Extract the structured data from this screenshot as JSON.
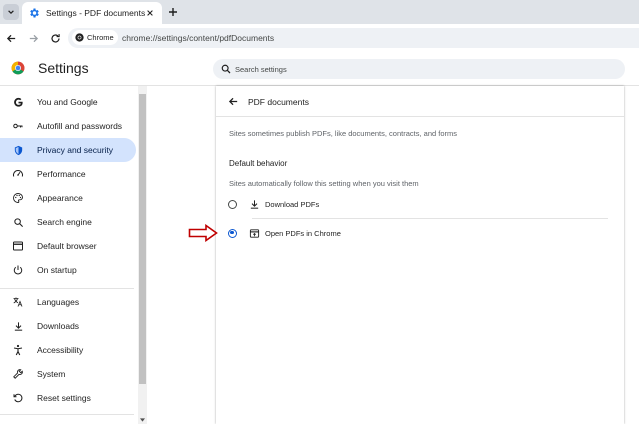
{
  "browser": {
    "tab": {
      "title": "Settings - PDF documents"
    },
    "chip_label": "Chrome",
    "url": "chrome://settings/content/pdfDocuments"
  },
  "header": {
    "title": "Settings",
    "search_placeholder": "Search settings"
  },
  "sidebar": {
    "items": [
      {
        "label": "You and Google",
        "icon": "google-icon",
        "active": false
      },
      {
        "label": "Autofill and passwords",
        "icon": "key-icon",
        "active": false
      },
      {
        "label": "Privacy and security",
        "icon": "shield-icon",
        "active": true
      },
      {
        "label": "Performance",
        "icon": "speedometer-icon",
        "active": false
      },
      {
        "label": "Appearance",
        "icon": "palette-icon",
        "active": false
      },
      {
        "label": "Search engine",
        "icon": "search-icon",
        "active": false
      },
      {
        "label": "Default browser",
        "icon": "browser-window-icon",
        "active": false
      },
      {
        "label": "On startup",
        "icon": "power-icon",
        "active": false
      },
      {
        "label": "Languages",
        "icon": "translate-icon",
        "active": false
      },
      {
        "label": "Downloads",
        "icon": "download-icon",
        "active": false
      },
      {
        "label": "Accessibility",
        "icon": "accessibility-icon",
        "active": false
      },
      {
        "label": "System",
        "icon": "wrench-icon",
        "active": false
      },
      {
        "label": "Reset settings",
        "icon": "reset-icon",
        "active": false
      }
    ]
  },
  "main": {
    "title": "PDF documents",
    "description": "Sites sometimes publish PDFs, like documents, contracts, and forms",
    "section_heading": "Default behavior",
    "section_subtext": "Sites automatically follow this setting when you visit them",
    "options": [
      {
        "label": "Download PDFs",
        "icon": "download-icon",
        "selected": false
      },
      {
        "label": "Open PDFs in Chrome",
        "icon": "open-in-browser-icon",
        "selected": true
      }
    ]
  },
  "colors": {
    "accent": "#0b57d0",
    "active_nav_bg": "#d3e3fd",
    "annotation_arrow": "#c00000"
  }
}
